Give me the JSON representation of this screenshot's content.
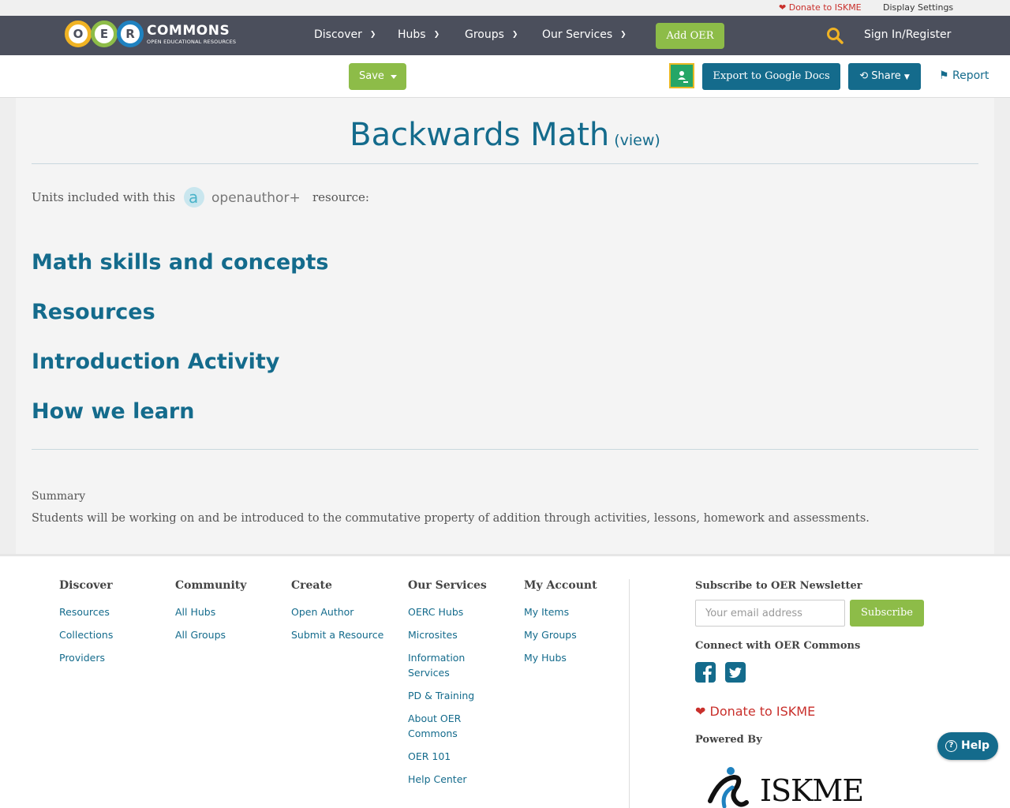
{
  "utility": {
    "donate": "Donate to ISKME",
    "display_settings": "Display Settings"
  },
  "logo": {
    "letters": [
      "O",
      "E",
      "R"
    ],
    "wordmark": "COMMONS",
    "tagline": "OPEN EDUCATIONAL RESOURCES"
  },
  "nav": {
    "items": [
      {
        "label": "Discover"
      },
      {
        "label": "Hubs"
      },
      {
        "label": "Groups"
      },
      {
        "label": "Our Services"
      }
    ],
    "add_oer": "Add OER",
    "sign_in": "Sign In/Register"
  },
  "actions": {
    "save": "Save",
    "export": "Export to Google Docs",
    "share": "Share",
    "report": "Report"
  },
  "page": {
    "title": "Backwards Math",
    "view_link": "(view)",
    "units_prefix": "Units included with this",
    "open_author_logo": "openauthor+",
    "units_suffix": "resource:",
    "units": [
      "Math skills and concepts",
      "Resources",
      "Introduction Activity",
      "How we learn"
    ],
    "summary_label": "Summary",
    "summary_text": "Students will be working on and be introduced to the commutative property of addition through activities, lessons, homework and assessments."
  },
  "footer": {
    "columns": [
      {
        "heading": "Discover",
        "links": [
          "Resources",
          "Collections",
          "Providers"
        ]
      },
      {
        "heading": "Community",
        "links": [
          "All Hubs",
          "All Groups"
        ]
      },
      {
        "heading": "Create",
        "links": [
          "Open Author",
          "Submit a Resource"
        ]
      },
      {
        "heading": "Our Services",
        "links": [
          "OERC Hubs",
          "Microsites",
          "Information Services",
          "PD & Training",
          "About OER Commons",
          "OER 101",
          "Help Center"
        ]
      },
      {
        "heading": "My Account",
        "links": [
          "My Items",
          "My Groups",
          "My Hubs"
        ]
      }
    ],
    "newsletter_title": "Subscribe to OER Newsletter",
    "email_placeholder": "Your email address",
    "subscribe": "Subscribe",
    "connect_title": "Connect with OER Commons",
    "social": [
      "facebook-icon",
      "twitter-icon"
    ],
    "donate": "Donate to ISKME",
    "powered_by": "Powered By",
    "powered_logo": "ISKME"
  },
  "help": {
    "label": "Help"
  },
  "colors": {
    "nav_bg": "#4b4f5c",
    "accent_green": "#8dbc48",
    "brand_blue": "#146b8c",
    "donate_red": "#c9302c",
    "logo_rings": [
      "#f0b323",
      "#8dbc48",
      "#1f82c0"
    ]
  }
}
